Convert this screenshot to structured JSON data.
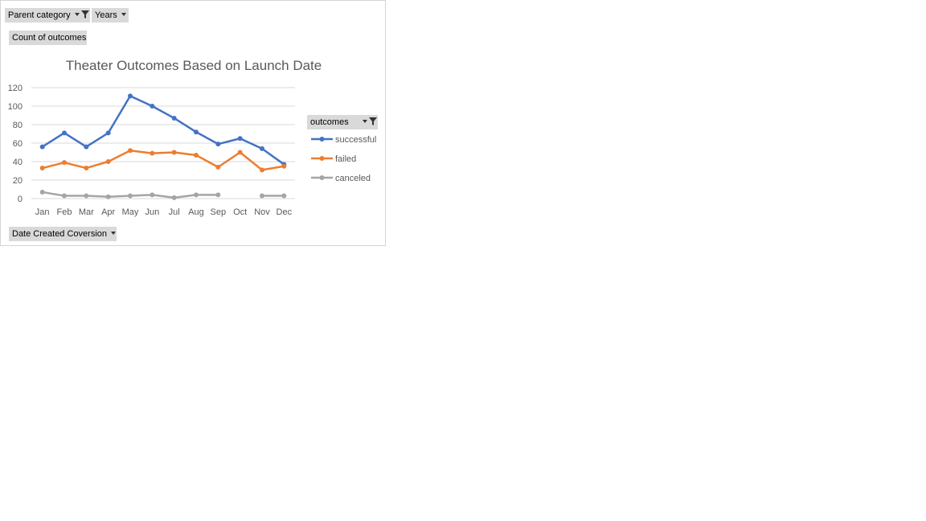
{
  "filters": {
    "parent_category": "Parent category",
    "years": "Years",
    "values_field": "Count of outcomes",
    "axis_field": "Date Created Coversion",
    "legend_field": "outcomes"
  },
  "colors": {
    "successful": "#4472c4",
    "failed": "#ed7d31",
    "canceled": "#a5a5a5",
    "gridline": "#d9d9d9",
    "field_button": "#d9d9d9"
  },
  "chart_data": {
    "type": "line",
    "title": "Theater Outcomes Based on Launch Date",
    "categories": [
      "Jan",
      "Feb",
      "Mar",
      "Apr",
      "May",
      "Jun",
      "Jul",
      "Aug",
      "Sep",
      "Oct",
      "Nov",
      "Dec"
    ],
    "ylim": [
      0,
      120
    ],
    "yticks": [
      0,
      20,
      40,
      60,
      80,
      100,
      120
    ],
    "grid": true,
    "legend_position": "right",
    "series": [
      {
        "name": "successful",
        "values": [
          56,
          71,
          56,
          71,
          111,
          100,
          87,
          72,
          59,
          65,
          54,
          37
        ]
      },
      {
        "name": "failed",
        "values": [
          33,
          39,
          33,
          40,
          52,
          49,
          50,
          47,
          34,
          50,
          31,
          35
        ]
      },
      {
        "name": "canceled",
        "values": [
          7,
          3,
          3,
          2,
          3,
          4,
          1,
          4,
          4,
          null,
          3,
          3
        ]
      }
    ]
  }
}
